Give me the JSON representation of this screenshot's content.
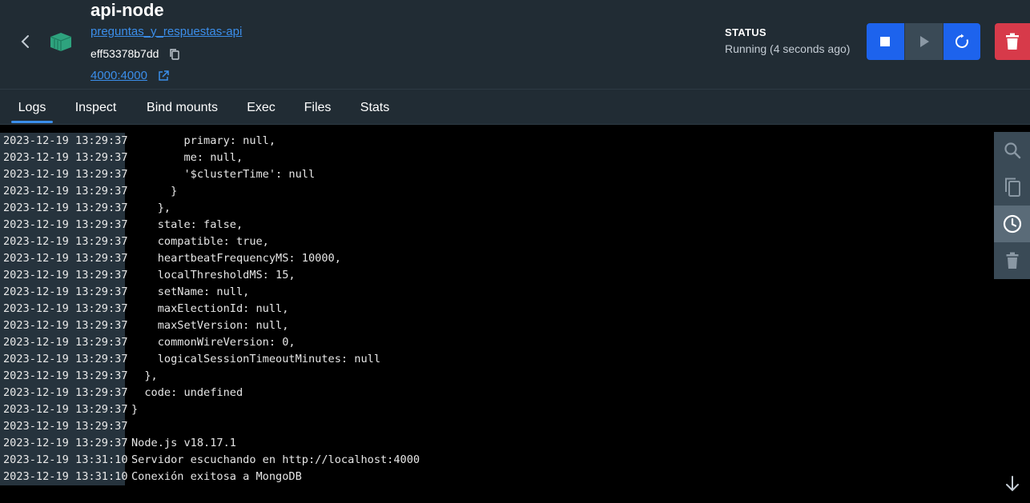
{
  "header": {
    "container_name": "api-node",
    "image_name": "preguntas_y_respuestas-api",
    "container_id": "eff53378b7dd",
    "port_mapping": "4000:4000",
    "status_label": "STATUS",
    "status_value": "Running (4 seconds ago)"
  },
  "icons": {
    "back": "chevron-left-icon",
    "container": "container-icon",
    "copy": "copy-icon",
    "external": "external-link-icon",
    "stop": "stop-icon",
    "start": "play-icon",
    "restart": "restart-icon",
    "delete": "trash-icon",
    "search": "search-icon",
    "copy_logs": "copy-icon",
    "timestamps": "clock-icon",
    "clear": "trash-icon",
    "scroll_bottom": "arrow-down-icon"
  },
  "tabs": [
    {
      "label": "Logs",
      "active": true
    },
    {
      "label": "Inspect",
      "active": false
    },
    {
      "label": "Bind mounts",
      "active": false
    },
    {
      "label": "Exec",
      "active": false
    },
    {
      "label": "Files",
      "active": false
    },
    {
      "label": "Stats",
      "active": false
    }
  ],
  "logs": [
    {
      "ts": "2023-12-19 13:29:37",
      "text": "        primary: null,"
    },
    {
      "ts": "2023-12-19 13:29:37",
      "text": "        me: null,"
    },
    {
      "ts": "2023-12-19 13:29:37",
      "text": "        '$clusterTime': null"
    },
    {
      "ts": "2023-12-19 13:29:37",
      "text": "      }"
    },
    {
      "ts": "2023-12-19 13:29:37",
      "text": "    },"
    },
    {
      "ts": "2023-12-19 13:29:37",
      "text": "    stale: false,"
    },
    {
      "ts": "2023-12-19 13:29:37",
      "text": "    compatible: true,"
    },
    {
      "ts": "2023-12-19 13:29:37",
      "text": "    heartbeatFrequencyMS: 10000,"
    },
    {
      "ts": "2023-12-19 13:29:37",
      "text": "    localThresholdMS: 15,"
    },
    {
      "ts": "2023-12-19 13:29:37",
      "text": "    setName: null,"
    },
    {
      "ts": "2023-12-19 13:29:37",
      "text": "    maxElectionId: null,"
    },
    {
      "ts": "2023-12-19 13:29:37",
      "text": "    maxSetVersion: null,"
    },
    {
      "ts": "2023-12-19 13:29:37",
      "text": "    commonWireVersion: 0,"
    },
    {
      "ts": "2023-12-19 13:29:37",
      "text": "    logicalSessionTimeoutMinutes: null"
    },
    {
      "ts": "2023-12-19 13:29:37",
      "text": "  },"
    },
    {
      "ts": "2023-12-19 13:29:37",
      "text": "  code: undefined"
    },
    {
      "ts": "2023-12-19 13:29:37",
      "text": "}"
    },
    {
      "ts": "2023-12-19 13:29:37",
      "text": ""
    },
    {
      "ts": "2023-12-19 13:29:37",
      "text": "Node.js v18.17.1"
    },
    {
      "ts": "2023-12-19 13:31:10",
      "text": "Servidor escuchando en http://localhost:4000"
    },
    {
      "ts": "2023-12-19 13:31:10",
      "text": "Conexión exitosa a MongoDB"
    }
  ],
  "colors": {
    "accent": "#1d63ed",
    "link": "#3b8eea",
    "danger": "#d73a4a",
    "header_bg": "#212c34",
    "log_bg": "#000000",
    "container_icon": "#2ea37e"
  }
}
